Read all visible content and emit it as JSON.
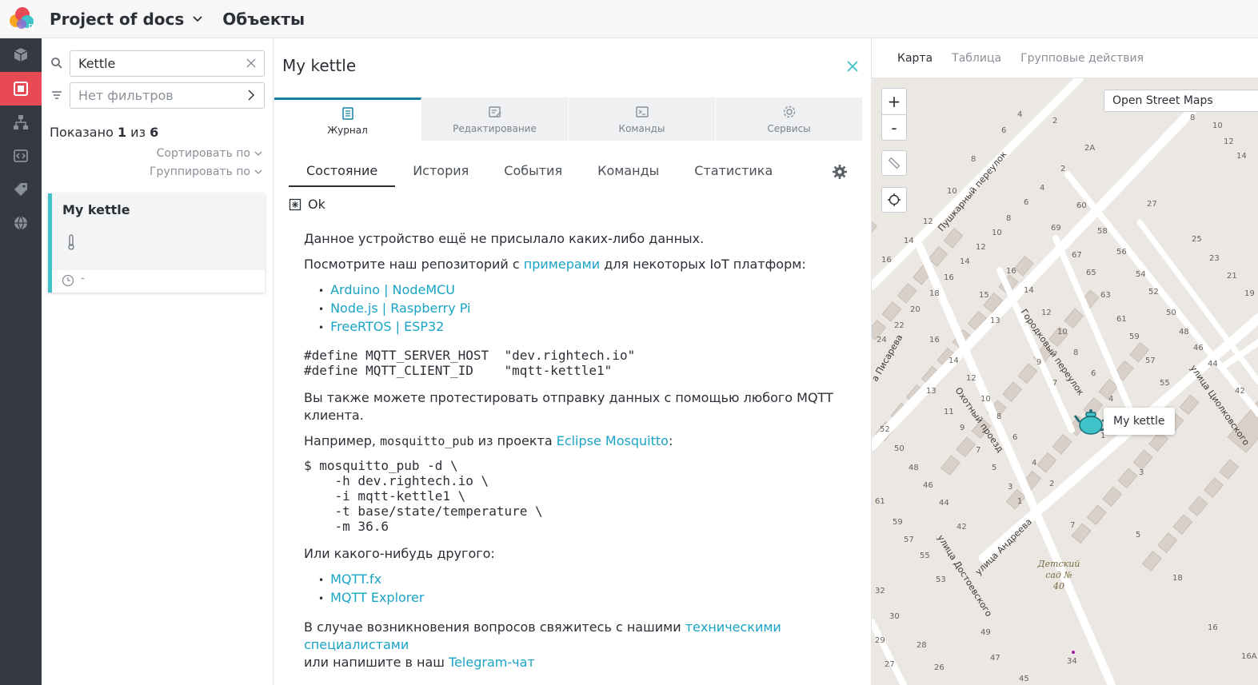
{
  "header": {
    "project_name": "Project of docs",
    "section_title": "Объекты"
  },
  "rail": {
    "items": [
      "cube-icon",
      "objects-icon",
      "hierarchy-icon",
      "code-icon",
      "tag-icon",
      "globe-icon"
    ],
    "active_index": 1,
    "active_color": "#e84a55"
  },
  "list": {
    "search": {
      "value": "Kettle"
    },
    "filter": {
      "value": "Нет фильтров"
    },
    "shown_prefix": "Показано ",
    "shown_count": "1",
    "shown_middle": " из ",
    "shown_total": "6",
    "sort_label": "Сортировать по",
    "group_label": "Группировать по",
    "items": [
      {
        "title": "My kettle",
        "icon": "thermometer-icon",
        "time": "-"
      }
    ]
  },
  "detail": {
    "title": "My kettle",
    "top_tabs": [
      {
        "label": "Журнал",
        "icon": "journal-icon",
        "active": true
      },
      {
        "label": "Редактирование",
        "icon": "edit-icon",
        "active": false
      },
      {
        "label": "Команды",
        "icon": "commands-icon",
        "active": false
      },
      {
        "label": "Сервисы",
        "icon": "services-icon",
        "active": false
      }
    ],
    "sub_tabs": [
      {
        "label": "Состояние",
        "active": true
      },
      {
        "label": "История",
        "active": false
      },
      {
        "label": "События",
        "active": false
      },
      {
        "label": "Команды",
        "active": false
      },
      {
        "label": "Статистика",
        "active": false
      }
    ],
    "status": "Ok",
    "content": {
      "p1": "Данное устройство ещё не присылало каких-либо данных.",
      "p2_before": "Посмотрите наш репозиторий с ",
      "p2_link": "примерами",
      "p2_after": " для некоторых IoT платформ:",
      "platforms": [
        "Arduino | NodeMCU",
        "Node.js | Raspberry Pi",
        "FreeRTOS | ESP32"
      ],
      "defines": "#define MQTT_SERVER_HOST  \"dev.rightech.io\"\n#define MQTT_CLIENT_ID    \"mqtt-kettle1\"",
      "p3": "Вы также можете протестировать отправку данных с помощью любого MQTT клиента.",
      "p4_before": "Например, ",
      "p4_code": "mosquitto_pub",
      "p4_middle": " из проекта ",
      "p4_link": "Eclipse Mosquitto",
      "p4_after": ":",
      "command": "$ mosquitto_pub -d \\\n    -h dev.rightech.io \\\n    -i mqtt-kettle1 \\\n    -t base/state/temperature \\\n    -m 36.6",
      "p5": "Или какого-нибудь другого:",
      "clients": [
        "MQTT.fx",
        "MQTT Explorer"
      ],
      "p6_before": "В случае возникновения вопросов свяжитесь с нашими ",
      "p6_link": "техническими специалистами",
      "p6_line2_before": "или напишите в наш ",
      "p6_link2": "Telegram-чат"
    }
  },
  "map": {
    "tabs": [
      {
        "label": "Карта",
        "active": true
      },
      {
        "label": "Таблица",
        "active": false
      },
      {
        "label": "Групповые действия",
        "active": false
      }
    ],
    "zoom_in": "+",
    "zoom_out": "-",
    "layer": "Open Street Maps",
    "marker_label": "My kettle",
    "streets": [
      "Пушкарный переулок",
      "Городковый переулок",
      "Охотный проезд",
      "улица Андреева",
      "улица Достоевского",
      "улица Циолковского",
      "а Писарева"
    ],
    "poi": [
      "Детский",
      "сад №",
      "40"
    ],
    "house_numbers": [
      "2",
      "4",
      "6",
      "8",
      "10",
      "12",
      "14",
      "16",
      "18",
      "20",
      "22",
      "24",
      "2А",
      "60",
      "58",
      "56",
      "54",
      "52",
      "50",
      "48",
      "46",
      "44",
      "42",
      "27",
      "25",
      "23",
      "21",
      "19",
      "69",
      "67",
      "65",
      "63",
      "61",
      "59",
      "57",
      "55",
      "53",
      "15",
      "13",
      "9",
      "7",
      "5",
      "3",
      "1",
      "12",
      "10",
      "8",
      "6",
      "4",
      "2",
      "16",
      "14",
      "12",
      "13",
      "11",
      "10",
      "9",
      "8",
      "7",
      "6",
      "5",
      "4",
      "3",
      "1",
      "52",
      "50",
      "48",
      "46",
      "44",
      "42",
      "61",
      "59",
      "57",
      "55",
      "53",
      "32",
      "30",
      "29",
      "28",
      "27",
      "26",
      "49",
      "47",
      "45",
      "34",
      "18",
      "16",
      "16А",
      "7",
      "5",
      "3",
      "2",
      "10",
      "12",
      "14"
    ]
  }
}
